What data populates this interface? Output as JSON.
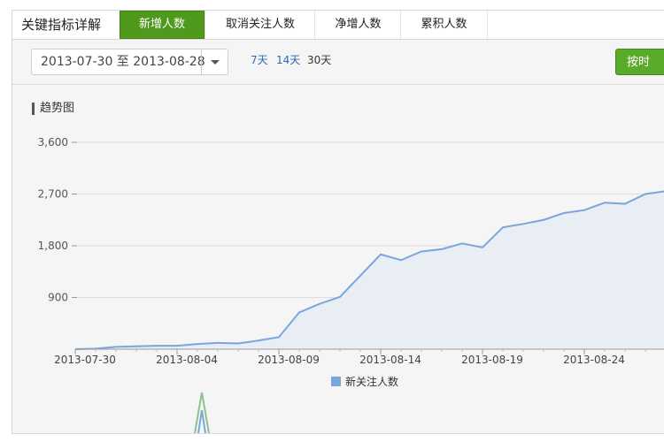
{
  "header": {
    "title": "关键指标详解",
    "tabs": [
      {
        "label": "新增人数",
        "active": true
      },
      {
        "label": "取消关注人数",
        "active": false
      },
      {
        "label": "净增人数",
        "active": false
      },
      {
        "label": "累积人数",
        "active": false
      }
    ]
  },
  "toolbar": {
    "date_range": "2013-07-30 至 2013-08-28",
    "quick_ranges": [
      {
        "label": "7天",
        "selected": false
      },
      {
        "label": "14天",
        "selected": false
      },
      {
        "label": "30天",
        "selected": true
      }
    ],
    "export_label": "按时"
  },
  "chart_title": "趋势图",
  "colors": {
    "accent_green": "#4f9a1d",
    "series": "#7aa6dd",
    "area": "#e9eef5"
  },
  "chart_data": {
    "type": "area",
    "x": [
      "2013-07-30",
      "2013-07-31",
      "2013-08-01",
      "2013-08-02",
      "2013-08-03",
      "2013-08-04",
      "2013-08-05",
      "2013-08-06",
      "2013-08-07",
      "2013-08-08",
      "2013-08-09",
      "2013-08-10",
      "2013-08-11",
      "2013-08-12",
      "2013-08-13",
      "2013-08-14",
      "2013-08-15",
      "2013-08-16",
      "2013-08-17",
      "2013-08-18",
      "2013-08-19",
      "2013-08-20",
      "2013-08-21",
      "2013-08-22",
      "2013-08-23",
      "2013-08-24",
      "2013-08-25",
      "2013-08-26",
      "2013-08-27",
      "2013-08-28"
    ],
    "x_tick_labels": [
      "2013-07-30",
      "2013-08-04",
      "2013-08-09",
      "2013-08-14",
      "2013-08-19",
      "2013-08-24"
    ],
    "series": [
      {
        "name": "新关注人数",
        "values": [
          0,
          10,
          40,
          50,
          60,
          60,
          90,
          110,
          100,
          150,
          210,
          640,
          790,
          910,
          1280,
          1650,
          1550,
          1700,
          1740,
          1840,
          1770,
          2120,
          2180,
          2250,
          2370,
          2420,
          2550,
          2530,
          2700,
          2750
        ]
      }
    ],
    "ylim": [
      0,
      3600
    ],
    "y_ticks": [
      900,
      1800,
      2700,
      3600
    ],
    "y_tick_labels": [
      "900",
      "1,800",
      "2,700",
      "3,600"
    ],
    "grid": true,
    "legend": "bottom-center"
  }
}
